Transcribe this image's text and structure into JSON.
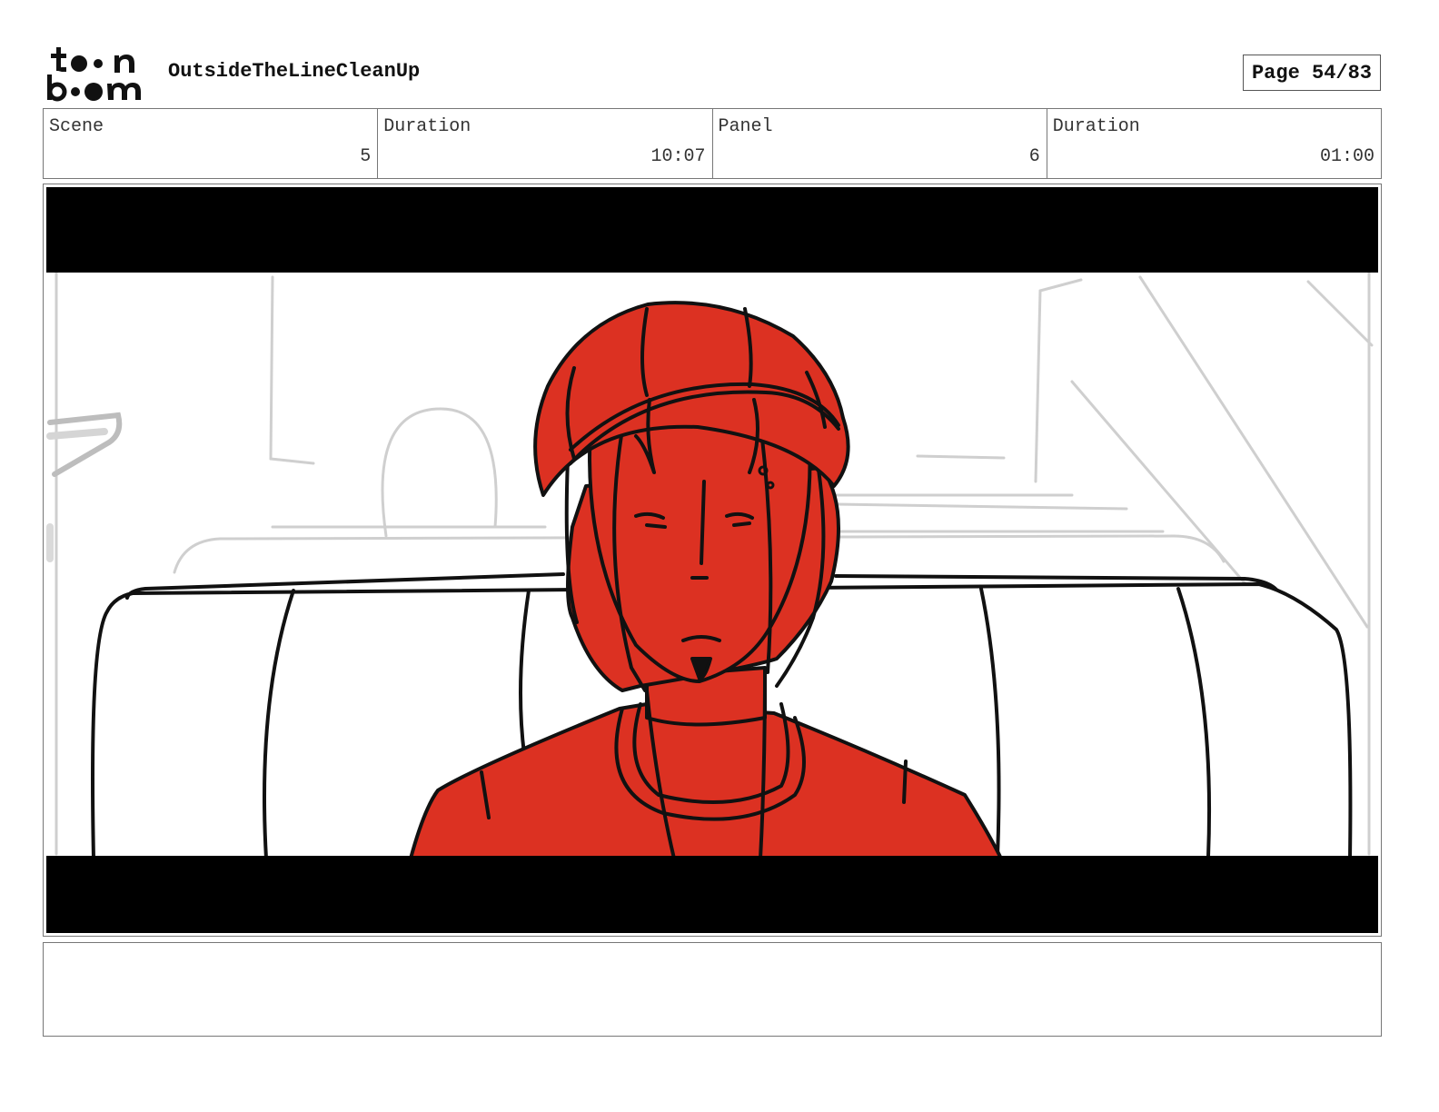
{
  "header": {
    "logo_text": "toon boom",
    "project_title": "OutsideTheLineCleanUp",
    "page_label": "Page 54/83"
  },
  "info": {
    "scene_label": "Scene",
    "scene_value": "5",
    "scene_duration_label": "Duration",
    "scene_duration_value": "10:07",
    "panel_label": "Panel",
    "panel_value": "6",
    "panel_duration_label": "Duration",
    "panel_duration_value": "01:00"
  },
  "colors": {
    "character_fill": "#dc3122",
    "letterbox": "#000000",
    "sketch_gray": "#c8c8c8"
  },
  "notes": {
    "text": ""
  }
}
